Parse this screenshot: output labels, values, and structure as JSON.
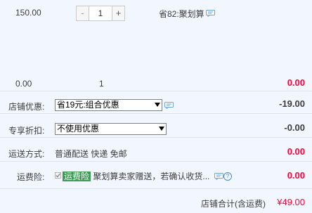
{
  "item": {
    "unit_price": "150.00",
    "quantity": "1",
    "minus_label": "-",
    "plus_label": "+",
    "promotion": "省82:聚划算"
  },
  "summary_row": {
    "price": "0.00",
    "quantity": "1",
    "total": "0.00"
  },
  "shop_discount": {
    "label": "店铺优惠:",
    "selected": "省19元:组合优惠",
    "amount": "-19.00"
  },
  "exclusive_discount": {
    "label": "专享折扣:",
    "selected": "不使用优惠",
    "amount": "-0.00"
  },
  "shipping": {
    "label": "运送方式:",
    "method": "普通配送 快递 免邮",
    "amount": "0.00"
  },
  "shipping_insurance": {
    "label": "运费险:",
    "tag": "运费险",
    "description": "聚划算卖家赠送，若确认收货...",
    "amount": "0.00"
  },
  "shop_total": {
    "label": "店铺合计(含运费)",
    "amount": "¥49.00"
  },
  "colors": {
    "accent_red": "#ff0036",
    "panel_bg": "#f2f7ff",
    "insurance_green": "#3e9b54"
  }
}
